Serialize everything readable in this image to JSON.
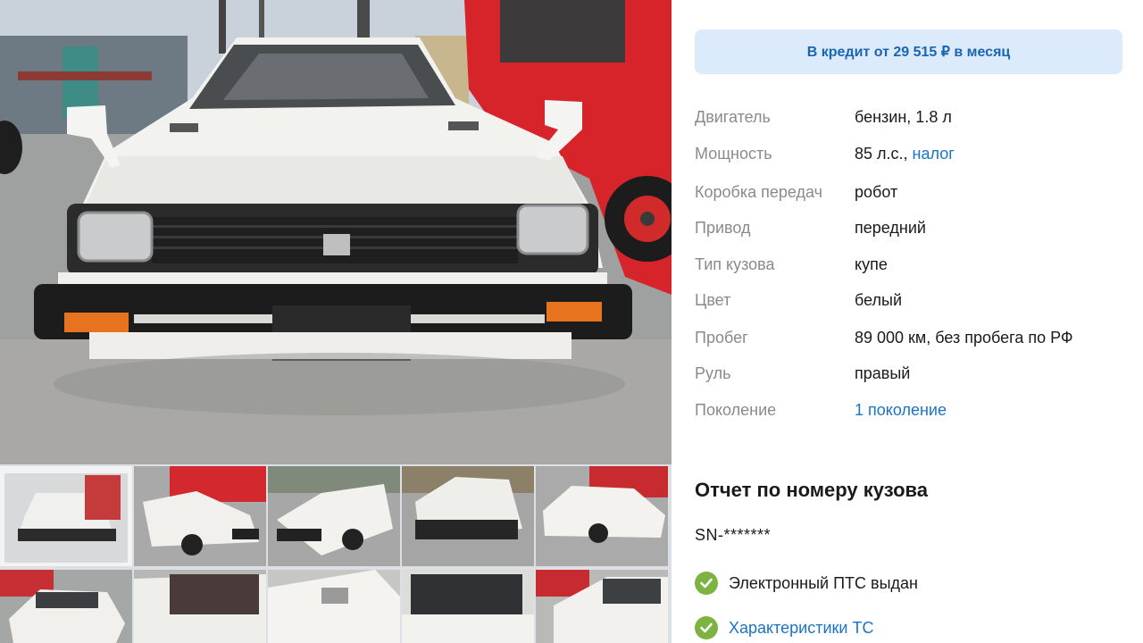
{
  "credit": {
    "label": "В кредит от 29 515 ₽ в месяц"
  },
  "specs": [
    {
      "label": "Двигатель",
      "value": "бензин, 1.8 л"
    },
    {
      "label": "Мощность",
      "value": "85 л.с.,",
      "link": "налог"
    },
    {
      "label": "Коробка передач",
      "value": "робот"
    },
    {
      "label": "Привод",
      "value": "передний"
    },
    {
      "label": "Тип кузова",
      "value": "купе"
    },
    {
      "label": "Цвет",
      "value": "белый"
    },
    {
      "label": "Пробег",
      "value": "89 000 км, без пробега по РФ"
    },
    {
      "label": "Руль",
      "value": "правый"
    },
    {
      "label": "Поколение",
      "link": "1 поколение"
    }
  ],
  "report": {
    "title": "Отчет по номеру кузова",
    "vin": "SN-*******",
    "checks": [
      {
        "text": "Электронный ПТС выдан",
        "is_link": false
      },
      {
        "text": "Характеристики ТС",
        "is_link": true
      }
    ]
  },
  "colors": {
    "accent_link": "#1a73c8",
    "credit_bg": "#dcebfb",
    "check_green": "#7cb342",
    "label_grey": "#8a8a8a"
  },
  "gallery": {
    "thumbnail_count": 10,
    "selected_thumbnail": 1
  }
}
